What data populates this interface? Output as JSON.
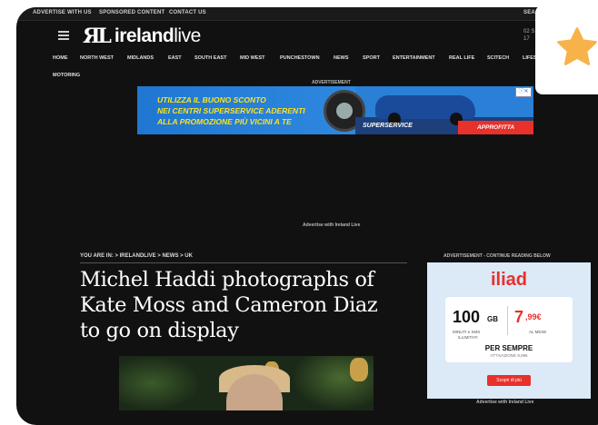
{
  "topbar": {
    "links": [
      "ADVERTISE WITH US",
      "SPONSORED CONTENT",
      "CONTACT US"
    ],
    "search_label": "Sea"
  },
  "header": {
    "logo_mark": "ЯL",
    "logo_name_bold": "ireland",
    "logo_name_light": "live",
    "right_text_1": "02 S",
    "right_text_2": "17"
  },
  "nav": {
    "items": [
      "HOME",
      "NORTH WEST",
      "MIDLANDS",
      "EAST",
      "SOUTH EAST",
      "MID WEST",
      "PUNCHESTOWN",
      "NEWS",
      "SPORT",
      "ENTERTAINMENT",
      "REAL LIFE",
      "SCITECH",
      "LIFES"
    ],
    "second_row": "MOTORING"
  },
  "top_ad": {
    "label": "ADVERTISEMENT",
    "line1": "UTILIZZA IL BUONO SCONTO",
    "line2": "NEI CENTRI SUPERSERVICE ADERENTI",
    "line3": "ALLA PROMOZIONE PIÙ VICINI A TE",
    "brand": "SUPERSERVICE",
    "cta": "APPROFITTA",
    "close": "ⓘ✕",
    "advertise_with": "Advertise with Ireland Live"
  },
  "article": {
    "breadcrumb": "You are in: > IRELANDLIVE > NEWS > UK",
    "headline_lines": [
      "Michel Haddi photographs of",
      "Kate Moss and Cameron Diaz",
      "to go on display"
    ]
  },
  "side_ad": {
    "label": "ADVERTISEMENT - CONTINUE READING BELOW",
    "brand": "iliad",
    "gb_value": "100",
    "gb_unit": "GB",
    "sub1": "MINUTI e SMS",
    "sub2": "ILLIMITATI",
    "price_main": "7",
    "price_cents": ",99€",
    "per_month": "AL MESE",
    "forever": "PER SEMPRE",
    "activation": "ATTIVAZIONE 9,99€",
    "button": "Scopri di più",
    "advertise_with": "Advertise with Ireland Live"
  },
  "favorite": {
    "icon": "star-icon",
    "color": "#f7b24a"
  }
}
